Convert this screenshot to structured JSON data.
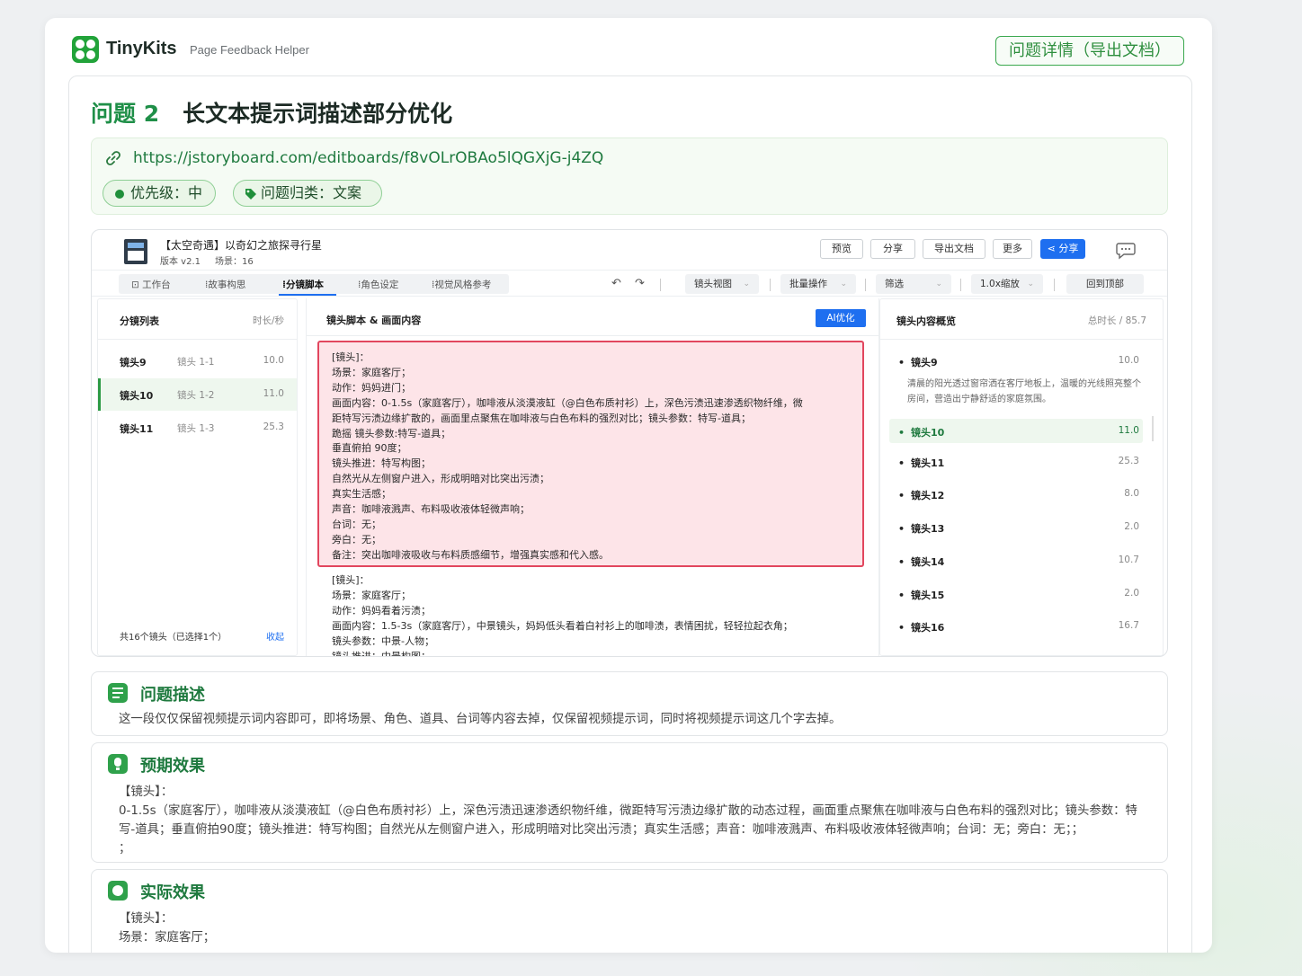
{
  "header": {
    "brand": "TinyKits",
    "subtitle": "Page Feedback Helper",
    "detail_button": "问题详情（导出文档）"
  },
  "issue": {
    "number_label": "问题 2",
    "title": "长文本提示词描述部分优化",
    "url": "https://jstoryboard.com/editboards/f8vOLrOBAo5lQGXjG-j4ZQ",
    "priority": "优先级：中",
    "category": "问题归类：文案"
  },
  "screenshot": {
    "project_title": "【太空奇遇】以奇幻之旅探寻行星",
    "version": "版本 v2.1",
    "scene_count": "场景：16",
    "toolbar_buttons": [
      "预览",
      "分享",
      "导出文档",
      "更多",
      "分享"
    ],
    "tabs": [
      "工作台",
      "故事构思",
      "分镜脚本",
      "角色设定",
      "视觉风格参考"
    ],
    "tools": [
      "镜头视图",
      "批量操作",
      "筛选",
      "1.0x缩放",
      "回到顶部"
    ],
    "left_panel": {
      "title": "分镜列表",
      "duration_header": "时长/秒",
      "rows": [
        {
          "name": "镜头9",
          "shot": "镜头 1-1",
          "duration": "10.0"
        },
        {
          "name": "镜头10",
          "shot": "镜头 1-2",
          "duration": "11.0"
        },
        {
          "name": "镜头11",
          "shot": "镜头 1-3",
          "duration": "25.3"
        }
      ],
      "footer": "共16个镜头（已选择1个）",
      "footer_link": "收起"
    },
    "mid_panel": {
      "title": "镜头脚本 & 画面内容",
      "ai_button": "AI优化",
      "highlighted_lines": [
        "[镜头]：",
        "场景：家庭客厅；",
        "动作：妈妈进门；",
        "画面内容：0-1.5s（家庭客厅），咖啡液从淡漠液缸（@白色布质衬衫）上，深色污渍迅速渗透织物纤维，微",
        "距特写污渍边缘扩散的，画面里点聚焦在咖啡液与白色布料的强烈对比；镜头参数：特写-道具；",
        "跪摇 镜头参数:特写-道具；",
        "垂直俯拍 90度；",
        "镜头推进：特写构图；",
        "自然光从左侧窗户进入，形成明暗对比突出污渍；",
        "真实生活感；",
        "声音：咖啡液溅声、布料吸收液体轻微声响；",
        "台词：无；",
        "旁白：无；",
        "备注：突出咖啡液吸收与布料质感细节，增强真实感和代入感。"
      ],
      "plain_lines": [
        "[镜头]：",
        "场景：家庭客厅；",
        "动作：妈妈看着污渍；",
        "画面内容：1.5-3s（家庭客厅），中景镜头，妈妈低头看着白衬衫上的咖啡渍，表情困扰，轻轻拉起衣角；",
        "镜头参数：中景-人物；",
        "镜头推进：中景构图；"
      ]
    },
    "right_panel": {
      "title": "镜头内容概览",
      "total": "总时长 / 85.7",
      "first": {
        "name": "镜头9",
        "duration": "10.0"
      },
      "first_desc": "清晨的阳光透过窗帘洒在客厅地板上，温暖的光线照亮整个房间，营造出宁静舒适的家庭氛围。",
      "items": [
        {
          "name": "镜头10",
          "duration": "11.0"
        },
        {
          "name": "镜头11",
          "duration": "25.3"
        },
        {
          "name": "镜头12",
          "duration": "8.0"
        },
        {
          "name": "镜头13",
          "duration": "2.0"
        },
        {
          "name": "镜头14",
          "duration": "10.7"
        },
        {
          "name": "镜头15",
          "duration": "2.0"
        },
        {
          "name": "镜头16",
          "duration": "16.7"
        }
      ]
    }
  },
  "sections": {
    "description": {
      "title": "问题描述",
      "body": "这一段仅仅保留视频提示词内容即可，即将场景、角色、道具、台词等内容去掉，仅保留视频提示词，同时将视频提示词这几个字去掉。"
    },
    "expected": {
      "title": "预期效果",
      "body1": "【镜头】：",
      "body2": "0-1.5s（家庭客厅），咖啡液从淡漠液缸（@白色布质衬衫）上，深色污渍迅速渗透织物纤维，微距特写污渍边缘扩散的动态过程，画面重点聚焦在咖啡液与白色布料的强烈对比；镜头参数：特写-道具；垂直俯拍90度；镜头推进：特写构图；自然光从左侧窗户进入，形成明暗对比突出污渍；真实生活感；声音：咖啡液溅声、布料吸收液体轻微声响；台词：无；旁白：无；；",
      "body3": "；"
    },
    "actual": {
      "title": "实际效果",
      "body1": "【镜头】：",
      "body2": "场景：家庭客厅；"
    }
  },
  "colors": {
    "brand_green": "#22a33a",
    "highlight_red": "#e2465e",
    "blue": "#1e6ff0"
  }
}
